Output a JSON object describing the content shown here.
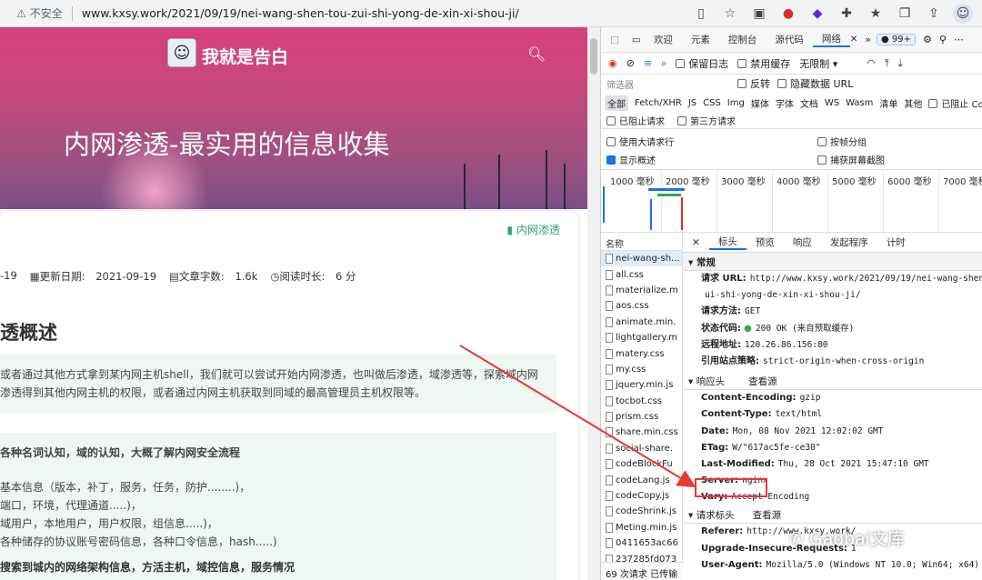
{
  "browser": {
    "security": "不安全",
    "url": "www.kxsy.work/2021/09/19/nei-wang-shen-tou-zui-shi-yong-de-xin-xi-shou-ji/"
  },
  "site": {
    "name": "我就是告白",
    "post_title": "内网渗透-最实用的信息收集",
    "category": "内网渗透",
    "meta": {
      "date_frag": "-19",
      "updated_label": "更新日期:",
      "updated": "2021-09-19",
      "words_label": "文章字数:",
      "words": "1.6k",
      "read_label": "阅读时长:",
      "read": "6 分"
    },
    "section_heading": "透概述",
    "quote1": [
      "或者通过其他方式拿到某内网主机shell，我们就可以尝试开始内网渗透，也叫做后渗透，域渗透等，探索域内网",
      "渗透得到其他内网主机的权限，或者通过内网主机获取到同域的最高管理员主机权限等。"
    ],
    "quote2_title": "各种名词认知，域的认知，大概了解内网安全流程",
    "quote2": [
      "基本信息（版本，补丁，服务，任务，防护........)，",
      "端口，环境，代理通道.....)，",
      "域用户，本地用户，用户权限，组信息.....)，",
      "各种储存的协议账号密码信息，各种口令信息，hash.....)"
    ],
    "bottom_fragment": "搜索到城内的网络架构信息，方活主机，域控信息，服务情况"
  },
  "devtools": {
    "tabs": [
      "欢迎",
      "元素",
      "控制台",
      "源代码",
      "网络"
    ],
    "badge": "99+",
    "toolbar": {
      "preserve_log": "保留日志",
      "disable_cache": "禁用缓存",
      "throttle": "无限制"
    },
    "filter": {
      "placeholder": "筛选器",
      "invert": "反转",
      "hide_data_url": "隐藏数据 URL"
    },
    "types": [
      "全部",
      "Fetch/XHR",
      "JS",
      "CSS",
      "Img",
      "媒体",
      "字体",
      "文档",
      "WS",
      "Wasm",
      "清单",
      "其他"
    ],
    "blocked_cookies": "已阻止 Co",
    "blocked_requests": "已阻止请求",
    "third_party": "第三方请求",
    "big_rows": "使用大请求行",
    "group_by_frame": "按帧分组",
    "show_overview": "显示概述",
    "capture_screenshots": "捕获屏幕截图",
    "timeline_ticks": [
      "1000 毫秒",
      "2000 毫秒",
      "3000 毫秒",
      "4000 毫秒",
      "5000 毫秒",
      "6000 毫秒",
      "7000 毫秒"
    ],
    "name_header": "名称",
    "files": [
      "nei-wang-sh...",
      "all.css",
      "materialize.m",
      "aos.css",
      "animate.min.",
      "lightgallery.m",
      "matery.css",
      "my.css",
      "jquery.min.js",
      "tocbot.css",
      "prism.css",
      "share.min.css",
      "social-share.",
      "codeBlockFu",
      "codeLang.js",
      "codeCopy.js",
      "codeShrink.js",
      "Meting.min.js",
      "0411653ac66",
      "237285fd073"
    ],
    "footer": "69 次请求  已传输",
    "detail_tabs": [
      "标头",
      "预览",
      "响应",
      "发起程序",
      "计时"
    ],
    "general_title": "常规",
    "general": [
      {
        "k": "请求 URL:",
        "v": "http://www.kxsy.work/2021/09/19/nei-wang-shen-tou-z"
      },
      {
        "k": "",
        "v": "ui-shi-yong-de-xin-xi-shou-ji/"
      },
      {
        "k": "请求方法:",
        "v": "GET"
      },
      {
        "k": "状态代码:",
        "v": "200 OK (来自预取缓存)"
      },
      {
        "k": "远程地址:",
        "v": "120.26.86.156:80"
      },
      {
        "k": "引用站点策略:",
        "v": "strict-origin-when-cross-origin"
      }
    ],
    "response_title": "响应头",
    "view_source": "查看源",
    "response": [
      {
        "k": "Content-Encoding:",
        "v": "gzip"
      },
      {
        "k": "Content-Type:",
        "v": "text/html"
      },
      {
        "k": "Date:",
        "v": "Mon, 08 Nov 2021 12:02:02 GMT"
      },
      {
        "k": "ETag:",
        "v": "W/\"617ac5fe-ce30\""
      },
      {
        "k": "Last-Modified:",
        "v": "Thu, 28 Oct 2021 15:47:10 GMT"
      },
      {
        "k": "Server:",
        "v": "nginx"
      },
      {
        "k": "Vary:",
        "v": "Accept-Encoding"
      }
    ],
    "request_title": "请求标头",
    "request": [
      {
        "k": "Referer:",
        "v": "http://www.kxsy.work/"
      },
      {
        "k": "Upgrade-Insecure-Requests:",
        "v": "1"
      },
      {
        "k": "User-Agent:",
        "v": "Mozilla/5.0 (Windows NT 10.0; Win64; x64) Appl"
      }
    ]
  },
  "watermark": "Gaobai文库",
  "colors": {
    "accent": "#1a73e8",
    "annotation": "#e53935",
    "category": "#2fa673"
  }
}
